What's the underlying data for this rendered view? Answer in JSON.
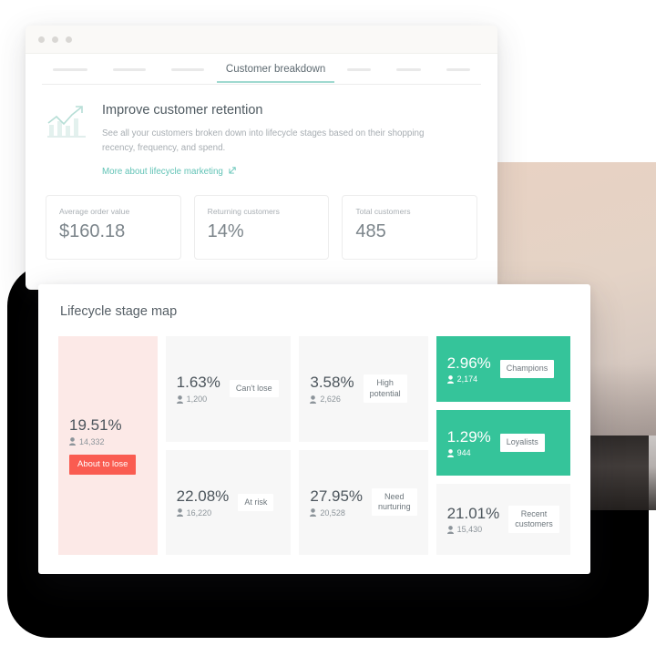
{
  "window": {
    "traffic_lights": [
      "dot-1",
      "dot-2",
      "dot-3"
    ],
    "tabs": {
      "active_label": "Customer breakdown",
      "placeholder_count": 6
    }
  },
  "hero": {
    "icon": "growth-chart-icon",
    "title": "Improve customer retention",
    "description": "See all your customers broken down into lifecycle stages based on their shopping recency, frequency, and spend.",
    "link_label": "More about lifecycle marketing",
    "link_icon": "external-link-icon"
  },
  "stats": [
    {
      "label": "Average order value",
      "value": "$160.18"
    },
    {
      "label": "Returning customers",
      "value": "14%"
    },
    {
      "label": "Total customers",
      "value": "485"
    }
  ],
  "lifecycle": {
    "title": "Lifecycle stage map",
    "tiles": [
      {
        "name": "about-to-lose",
        "percent": "19.51%",
        "count": "14,332",
        "badge": "About to lose",
        "style": "pink"
      },
      {
        "name": "cant-lose",
        "percent": "1.63%",
        "count": "1,200",
        "badge": "Can't lose",
        "style": "grey"
      },
      {
        "name": "at-risk",
        "percent": "22.08%",
        "count": "16,220",
        "badge": "At risk",
        "style": "grey"
      },
      {
        "name": "high-potential",
        "percent": "3.58%",
        "count": "2,626",
        "badge": "High\npotential",
        "style": "grey"
      },
      {
        "name": "need-nurturing",
        "percent": "27.95%",
        "count": "20,528",
        "badge": "Need\nnurturing",
        "style": "grey"
      },
      {
        "name": "champions",
        "percent": "2.96%",
        "count": "2,174",
        "badge": "Champions",
        "style": "green"
      },
      {
        "name": "loyalists",
        "percent": "1.29%",
        "count": "944",
        "badge": "Loyalists",
        "style": "green"
      },
      {
        "name": "recent-customers",
        "percent": "21.01%",
        "count": "15,430",
        "badge": "Recent\ncustomers",
        "style": "white"
      }
    ]
  },
  "colors": {
    "accent_teal": "#62c3b6",
    "green_tile": "#35c49a",
    "danger_red": "#fa5c51",
    "pink_tile": "#fce9e7",
    "grey_tile": "#f7f7f7"
  }
}
